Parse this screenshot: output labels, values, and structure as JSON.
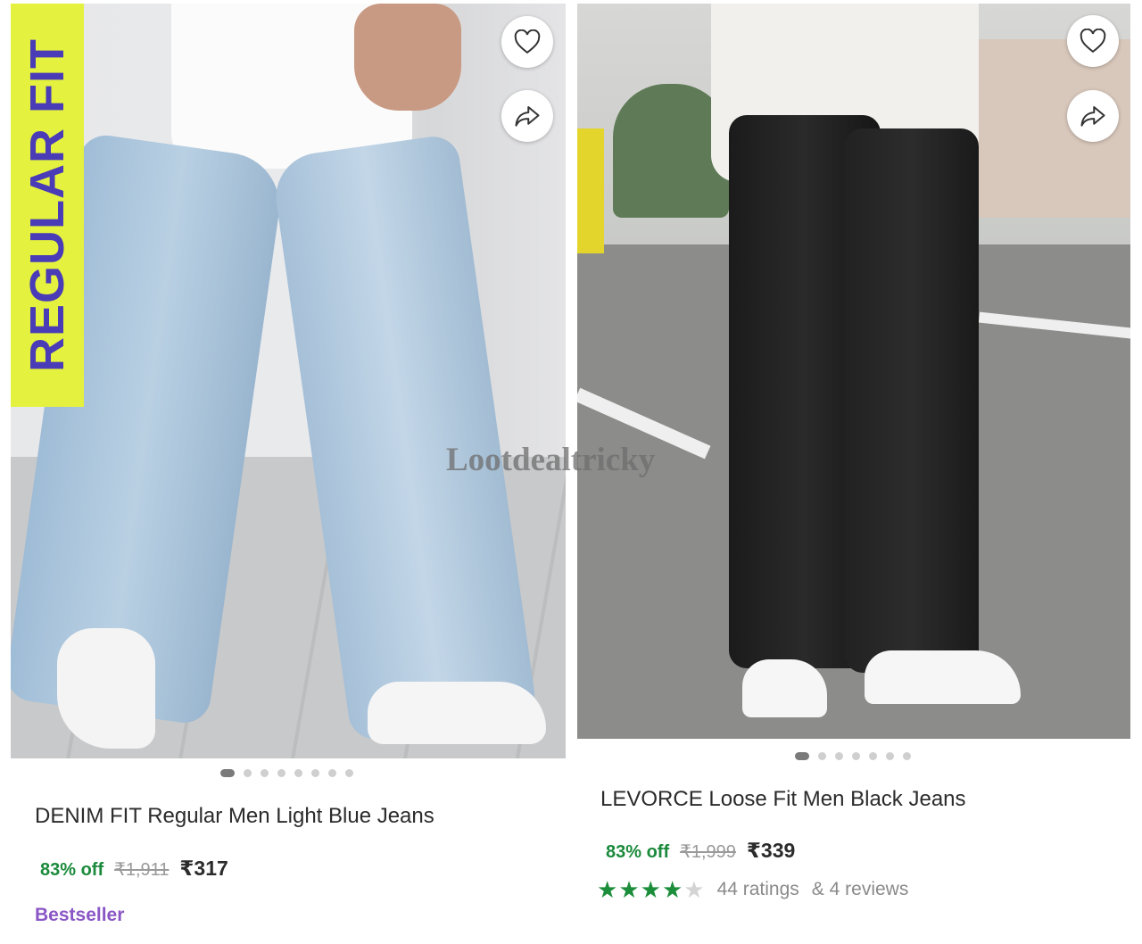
{
  "products": [
    {
      "badge": "REGULAR FIT",
      "title": "DENIM FIT Regular Men Light Blue Jeans",
      "discount": "83% off",
      "mrp": "₹1,911",
      "price": "₹317",
      "tag": "Bestseller",
      "carousel": {
        "total": 8,
        "active": 1
      },
      "icons": {
        "wishlist": "heart-icon",
        "share": "share-icon"
      }
    },
    {
      "title": "LEVORCE Loose Fit Men Black Jeans",
      "discount": "83% off",
      "mrp": "₹1,999",
      "price": "₹339",
      "rating": {
        "stars": 4,
        "max": 5,
        "ratings_text": "44 ratings",
        "reviews_text": "& 4 reviews"
      },
      "carousel": {
        "total": 7,
        "active": 1
      },
      "icons": {
        "wishlist": "heart-icon",
        "share": "share-icon"
      }
    }
  ],
  "watermark": "Lootdealtricky",
  "colors": {
    "discount_green": "#1b8a3c",
    "star_green": "#1c8d3b",
    "bestseller_purple": "#8a57c5",
    "badge_yellow": "#e4f23f",
    "badge_text_purple": "#4a3bb7"
  }
}
